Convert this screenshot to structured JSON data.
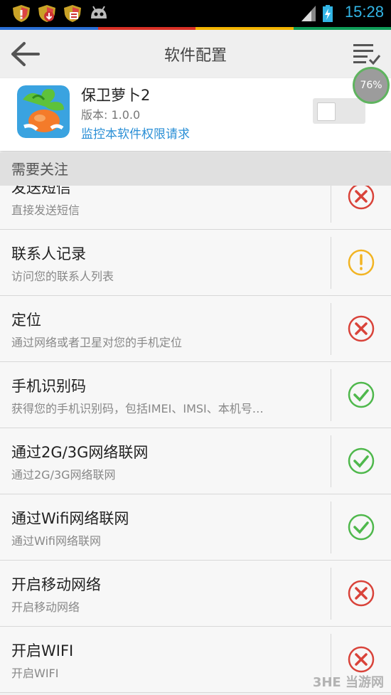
{
  "status_bar": {
    "time": "15:28",
    "notification_icons": [
      "shield-warning-icon",
      "shield-download-icon",
      "shield-block-icon",
      "android-robot-icon"
    ],
    "system_icons": [
      "signal-icon",
      "battery-charging-icon"
    ]
  },
  "color_strip": [
    "#2a6fd6",
    "#d93025",
    "#f4b400",
    "#0f9d58"
  ],
  "action_bar": {
    "title": "软件配置"
  },
  "app": {
    "name": "保卫萝卜2",
    "version": "版本: 1.0.0",
    "link": "监控本软件权限请求",
    "toggle_on": false
  },
  "progress_badge": "76%",
  "section_header": "需要关注",
  "permissions": [
    {
      "title": "发送短信",
      "desc": "直接发送短信",
      "status": "deny"
    },
    {
      "title": "联系人记录",
      "desc": "访问您的联系人列表",
      "status": "ask"
    },
    {
      "title": "定位",
      "desc": "通过网络或者卫星对您的手机定位",
      "status": "deny"
    },
    {
      "title": "手机识别码",
      "desc": "获得您的手机识别码，包括IMEI、IMSI、本机号…",
      "status": "allow"
    },
    {
      "title": "通过2G/3G网络联网",
      "desc": "通过2G/3G网络联网",
      "status": "allow"
    },
    {
      "title": "通过Wifi网络联网",
      "desc": "通过Wifi网络联网",
      "status": "allow"
    },
    {
      "title": "开启移动网络",
      "desc": "开启移动网络",
      "status": "deny"
    },
    {
      "title": "开启WIFI",
      "desc": "开启WIFI",
      "status": "deny"
    }
  ],
  "status_colors": {
    "deny": "#d9433a",
    "ask": "#f2b423",
    "allow": "#4fb84c"
  },
  "watermark": "3HE 当游网"
}
